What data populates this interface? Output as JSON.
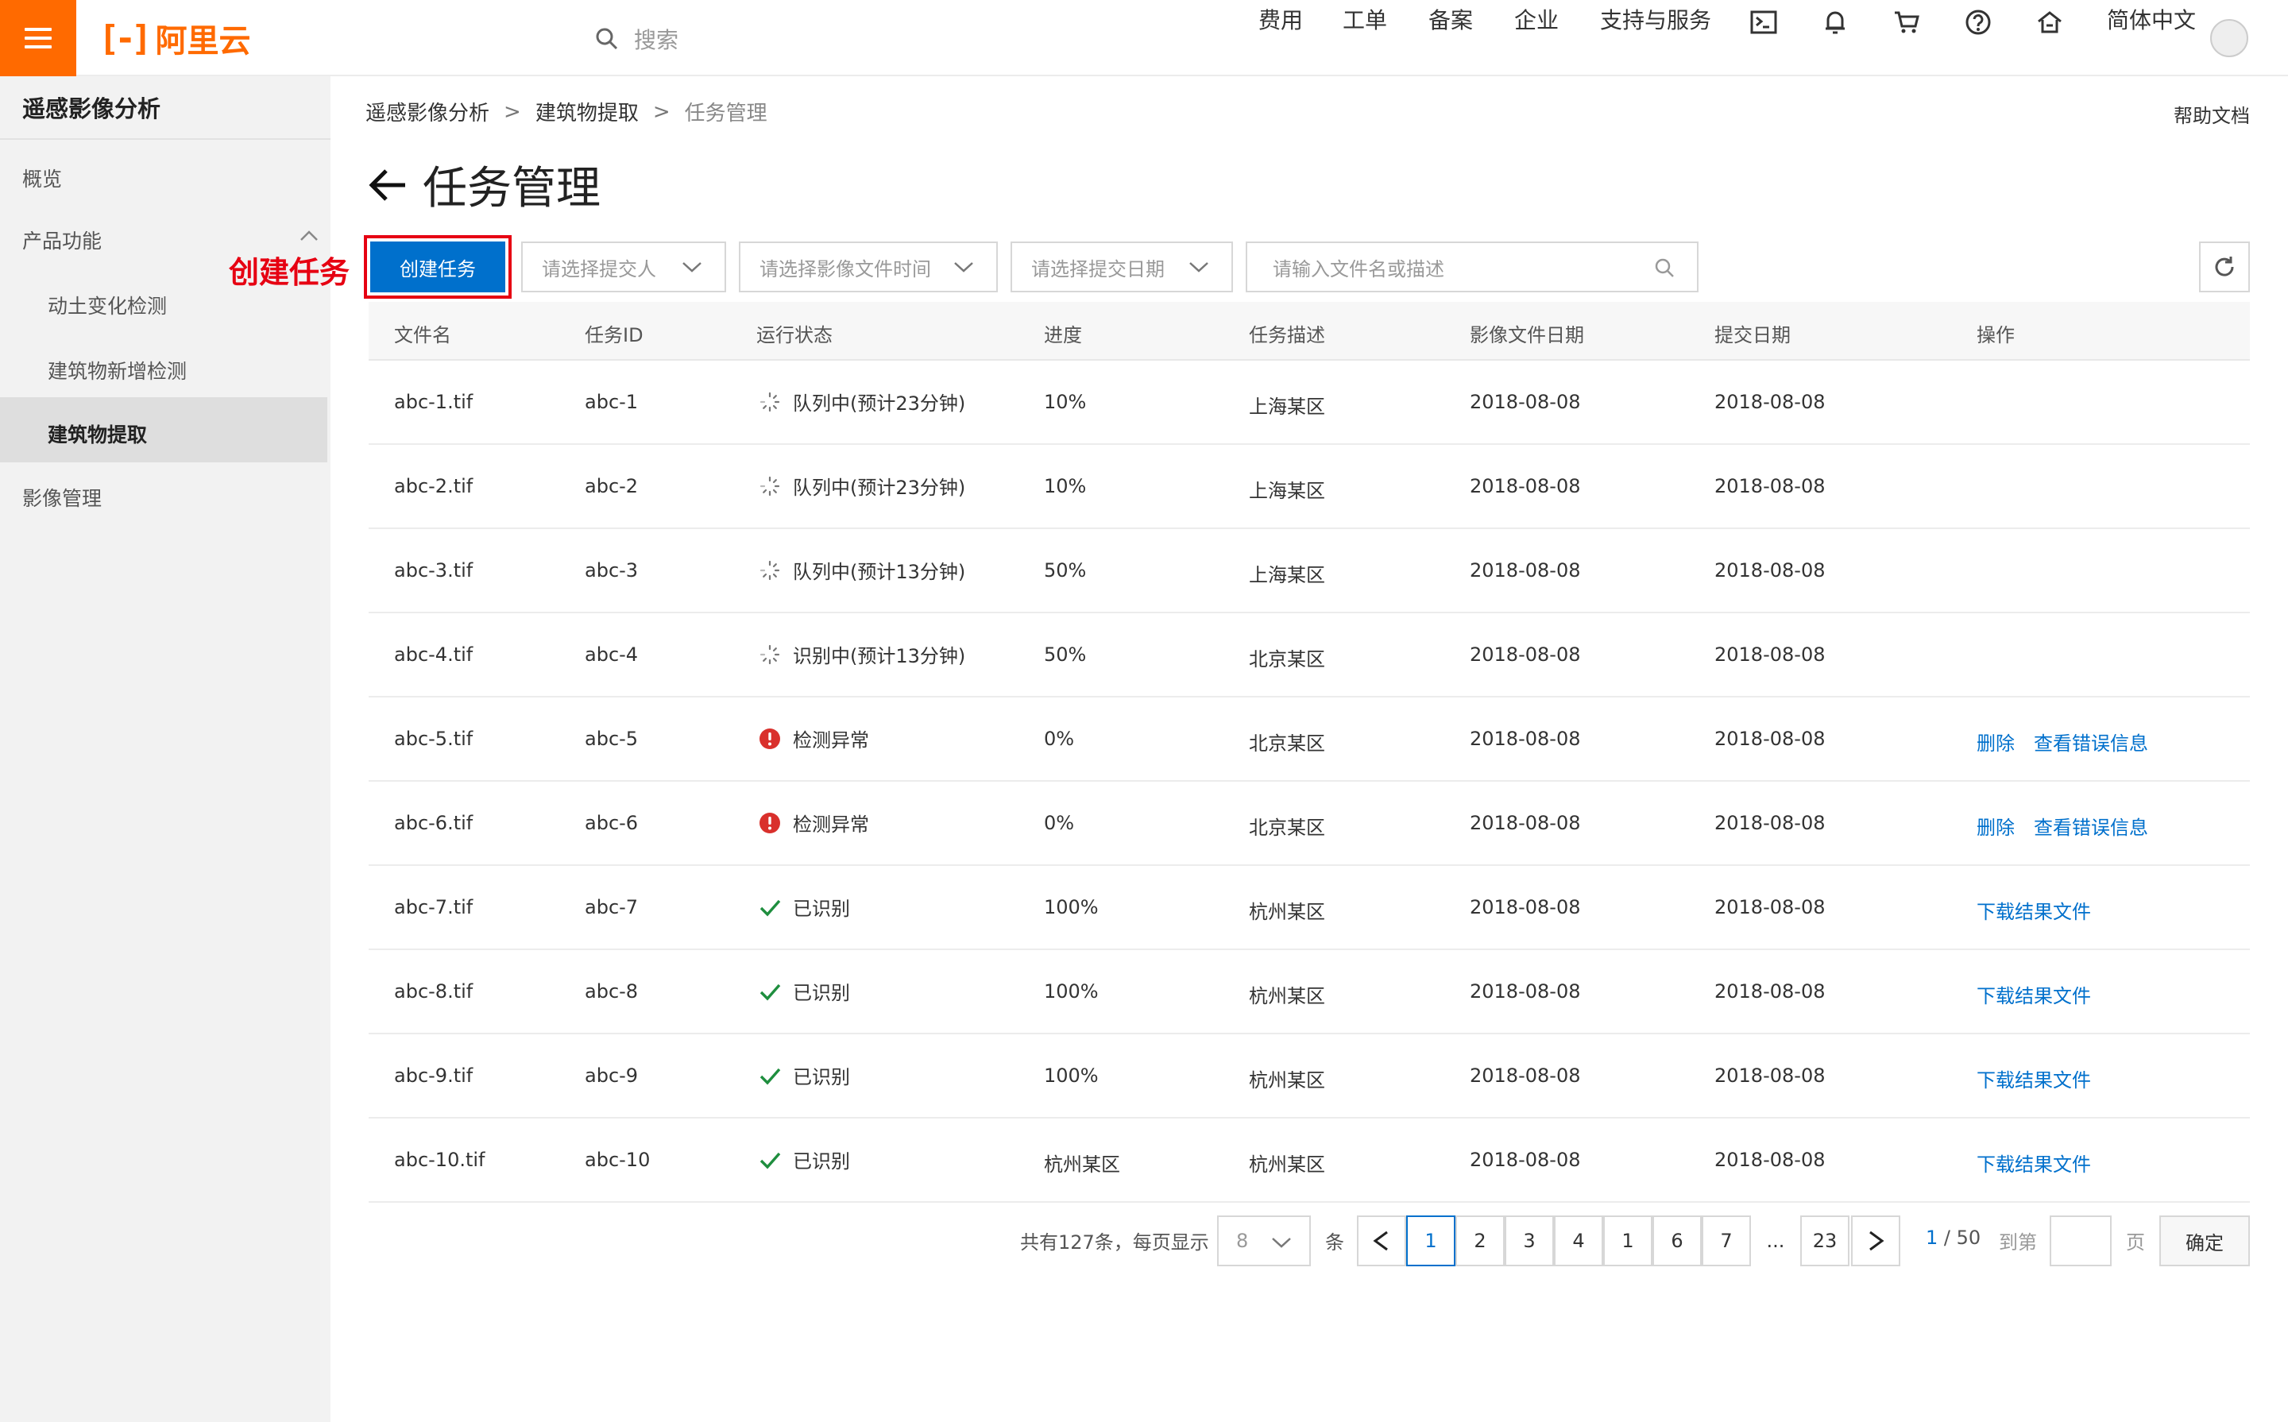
{
  "topbar": {
    "logo_text": "阿里云",
    "search_placeholder": "搜索",
    "nav": [
      "费用",
      "工单",
      "备案",
      "企业",
      "支持与服务"
    ],
    "language": "简体中文",
    "icons": [
      "terminal-icon",
      "bell-icon",
      "cart-icon",
      "help-icon",
      "home-icon"
    ]
  },
  "sidebar": {
    "title": "遥感影像分析",
    "items": {
      "overview": "概览",
      "product_features": "产品功能",
      "earth_change": "动土变化检测",
      "building_new": "建筑物新增检测",
      "building_extract": "建筑物提取",
      "image_mgmt": "影像管理"
    }
  },
  "breadcrumb": [
    "遥感影像分析",
    "建筑物提取",
    "任务管理"
  ],
  "help_doc": "帮助文档",
  "page_title": "任务管理",
  "annotation": "创建任务",
  "toolbar": {
    "create_label": "创建任务",
    "submitter_placeholder": "请选择提交人",
    "image_time_placeholder": "请选择影像文件时间",
    "submit_date_placeholder": "请选择提交日期",
    "search_placeholder": "请输入文件名或描述"
  },
  "table": {
    "headers": [
      "文件名",
      "任务ID",
      "运行状态",
      "进度",
      "任务描述",
      "影像文件日期",
      "提交日期",
      "操作"
    ],
    "rows": [
      {
        "file": "abc-1.tif",
        "id": "abc-1",
        "status": "队列中(预计23分钟)",
        "status_type": "pending",
        "progress": "10%",
        "desc": "上海某区",
        "image_date": "2018-08-08",
        "submit_date": "2018-08-08",
        "ops": []
      },
      {
        "file": "abc-2.tif",
        "id": "abc-2",
        "status": "队列中(预计23分钟)",
        "status_type": "pending",
        "progress": "10%",
        "desc": "上海某区",
        "image_date": "2018-08-08",
        "submit_date": "2018-08-08",
        "ops": []
      },
      {
        "file": "abc-3.tif",
        "id": "abc-3",
        "status": "队列中(预计13分钟)",
        "status_type": "pending",
        "progress": "50%",
        "desc": "上海某区",
        "image_date": "2018-08-08",
        "submit_date": "2018-08-08",
        "ops": []
      },
      {
        "file": "abc-4.tif",
        "id": "abc-4",
        "status": "识别中(预计13分钟)",
        "status_type": "pending",
        "progress": "50%",
        "desc": "北京某区",
        "image_date": "2018-08-08",
        "submit_date": "2018-08-08",
        "ops": []
      },
      {
        "file": "abc-5.tif",
        "id": "abc-5",
        "status": "检测异常",
        "status_type": "error",
        "progress": "0%",
        "desc": "北京某区",
        "image_date": "2018-08-08",
        "submit_date": "2018-08-08",
        "ops": [
          "删除",
          "查看错误信息"
        ]
      },
      {
        "file": "abc-6.tif",
        "id": "abc-6",
        "status": "检测异常",
        "status_type": "error",
        "progress": "0%",
        "desc": "北京某区",
        "image_date": "2018-08-08",
        "submit_date": "2018-08-08",
        "ops": [
          "删除",
          "查看错误信息"
        ]
      },
      {
        "file": "abc-7.tif",
        "id": "abc-7",
        "status": "已识别",
        "status_type": "done",
        "progress": "100%",
        "desc": "杭州某区",
        "image_date": "2018-08-08",
        "submit_date": "2018-08-08",
        "ops": [
          "下载结果文件"
        ]
      },
      {
        "file": "abc-8.tif",
        "id": "abc-8",
        "status": "已识别",
        "status_type": "done",
        "progress": "100%",
        "desc": "杭州某区",
        "image_date": "2018-08-08",
        "submit_date": "2018-08-08",
        "ops": [
          "下载结果文件"
        ]
      },
      {
        "file": "abc-9.tif",
        "id": "abc-9",
        "status": "已识别",
        "status_type": "done",
        "progress": "100%",
        "desc": "杭州某区",
        "image_date": "2018-08-08",
        "submit_date": "2018-08-08",
        "ops": [
          "下载结果文件"
        ]
      },
      {
        "file": "abc-10.tif",
        "id": "abc-10",
        "status": "已识别",
        "status_type": "done",
        "progress": "杭州某区",
        "desc": "杭州某区",
        "image_date": "2018-08-08",
        "submit_date": "2018-08-08",
        "ops": [
          "下载结果文件"
        ]
      }
    ]
  },
  "pagination": {
    "total_text": "共有127条，每页显示",
    "page_size": "8",
    "unit": "条",
    "pages": [
      "1",
      "2",
      "3",
      "4",
      "1",
      "6",
      "7",
      "...",
      "23"
    ],
    "current_page": "1",
    "page_count": "/ 50",
    "goto_label": "到第",
    "page_unit": "页",
    "confirm_label": "确定"
  },
  "colors": {
    "brand_orange": "#ff6a00",
    "primary_blue": "#0070cc",
    "error_red": "#d9302c",
    "success_green": "#1e8e3e",
    "annotation_red": "#e60012"
  }
}
